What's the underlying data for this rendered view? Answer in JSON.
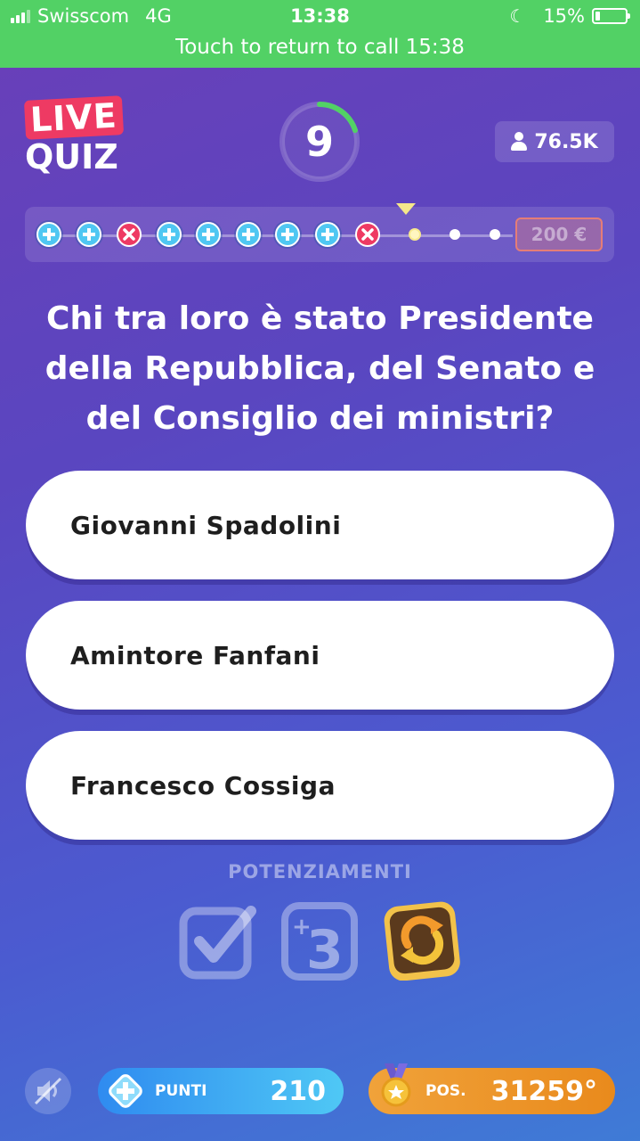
{
  "status_bar": {
    "carrier": "Swisscom",
    "network": "4G",
    "time": "13:38",
    "battery": "15%",
    "call_banner": "Touch to return to call 15:38"
  },
  "logo": {
    "line1": "LIVE",
    "line2": "QUIZ"
  },
  "timer": {
    "seconds": "9",
    "ring_fraction": 0.2
  },
  "viewers": {
    "count": "76.5K"
  },
  "progress": {
    "steps": [
      "correct",
      "correct",
      "wrong",
      "correct",
      "correct",
      "correct",
      "correct",
      "correct",
      "wrong",
      "current",
      "upcoming",
      "upcoming"
    ],
    "prize": "200 €"
  },
  "question": {
    "text": "Chi tra loro è stato Presidente della Repubblica, del Senato e del Consiglio dei ministri?"
  },
  "answers": [
    {
      "label": "Giovanni Spadolini"
    },
    {
      "label": "Amintore Fanfani"
    },
    {
      "label": "Francesco Cossiga"
    }
  ],
  "powerups": {
    "title": "POTENZIAMENTI",
    "items": [
      {
        "icon": "checkmark-powerup-icon",
        "enabled": false
      },
      {
        "icon": "plus-three-powerup-icon",
        "enabled": false
      },
      {
        "icon": "refresh-powerup-icon",
        "enabled": true
      }
    ]
  },
  "bottom": {
    "points_label": "PUNTI",
    "points_value": "210",
    "position_label": "POS.",
    "position_value": "31259°"
  },
  "colors": {
    "status_green": "#52d165",
    "live_pink": "#ee3a63",
    "correct_blue": "#4fc7f2",
    "points_blue": "#2f8bf0",
    "position_orange": "#f0a23a"
  }
}
